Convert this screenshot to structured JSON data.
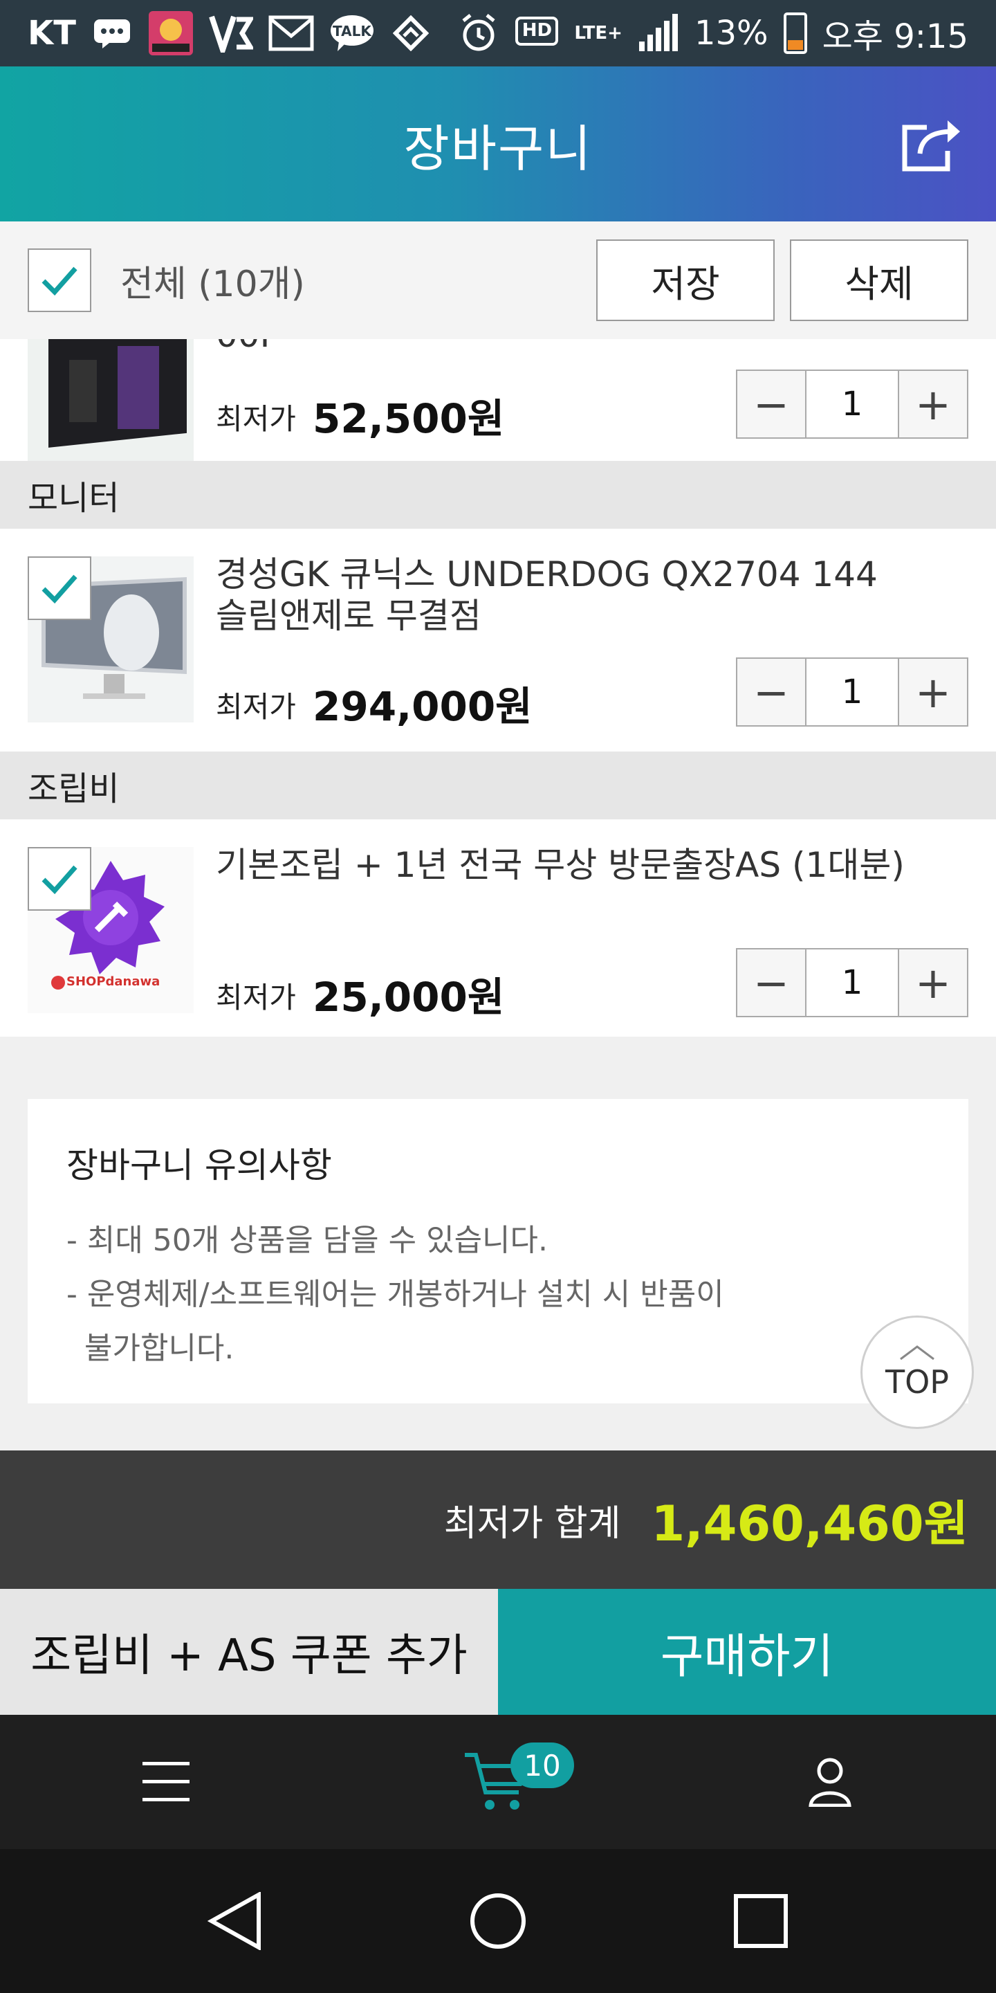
{
  "status_bar": {
    "carrier": "KT",
    "talk_label": "TALK",
    "hd_label": "HD",
    "network": "LTE+",
    "battery": "13%",
    "battery_level": 0.13,
    "time": "오후 9:15"
  },
  "header": {
    "title": "장바구니",
    "share_icon": "share-icon"
  },
  "select_bar": {
    "select_all_label": "전체 (10개)",
    "select_all_checked": true,
    "save_label": "저장",
    "delete_label": "삭제"
  },
  "items": [
    {
      "name_partial": "00I",
      "price_label": "최저가",
      "price": "52,500원",
      "quantity": "1"
    },
    {
      "category": "모니터",
      "checked": true,
      "name_line1": "경성GK 큐닉스 UNDERDOG QX2704 144",
      "name_line2": "슬림앤제로 무결점",
      "price_label": "최저가",
      "price": "294,000원",
      "quantity": "1"
    },
    {
      "category": "조립비",
      "checked": true,
      "name_line1": "기본조립 + 1년 전국 무상 방문출장AS (1대분)",
      "thumb_brand": "SHOPdanawa",
      "price_label": "최저가",
      "price": "25,000원",
      "quantity": "1"
    }
  ],
  "stepper": {
    "minus": "−",
    "plus": "+"
  },
  "notice": {
    "title": "장바구니 유의사항",
    "line1": "- 최대 50개 상품을 담을 수 있습니다.",
    "line2": "- 운영체제/소프트웨어는 개봉하거나 설치 시 반품이",
    "line3": "불가합니다."
  },
  "top_button": "TOP",
  "total": {
    "label": "최저가 합계",
    "value": "1,460,460원"
  },
  "actions": {
    "coupon_label": "조립비 + AS 쿠폰 추가",
    "buy_label": "구매하기"
  },
  "bottom_nav": {
    "cart_count": "10"
  },
  "colors": {
    "accent": "#129fa1",
    "total_value": "#d6ea16",
    "header_gradient_start": "#11a4a3",
    "header_gradient_end": "#4b52c4"
  }
}
